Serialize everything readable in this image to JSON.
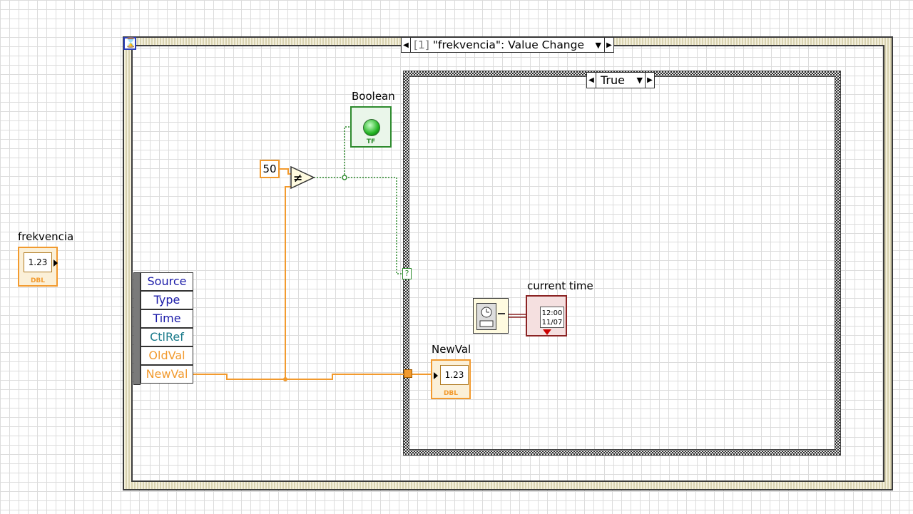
{
  "event_structure": {
    "selector_index": "[1]",
    "selector_label": "\"frekvencia\": Value Change"
  },
  "case_structure": {
    "selector_label": "True"
  },
  "controls": {
    "frekvencia_label": "frekvencia",
    "frekvencia_display": "1.23",
    "frekvencia_type": "DBL",
    "boolean_label": "Boolean",
    "boolean_type": "TF",
    "constant_value": "50",
    "newval_label": "NewVal",
    "newval_display": "1.23",
    "newval_type": "DBL",
    "current_time_label": "current time",
    "current_time_display_line1": "12:00",
    "current_time_display_line2": "11/07"
  },
  "event_data_node": {
    "items": [
      {
        "label": "Source",
        "color": "#1a1aa8"
      },
      {
        "label": "Type",
        "color": "#1a1aa8"
      },
      {
        "label": "Time",
        "color": "#1a1aa8"
      },
      {
        "label": "CtlRef",
        "color": "#1a7a8a"
      },
      {
        "label": "OldVal",
        "color": "#f29a2e"
      },
      {
        "label": "NewVal",
        "color": "#f29a2e"
      }
    ]
  },
  "colors": {
    "dbl_wire": "#f29a2e",
    "boolean_wire": "#2e8b2e",
    "timestamp_wire": "#8b2323",
    "event_frame_icon": "#2b3fb8"
  },
  "icons": {
    "not_equal": "not-equal-icon",
    "case_selector_terminal": "?",
    "clock": "get-date-time-icon"
  }
}
